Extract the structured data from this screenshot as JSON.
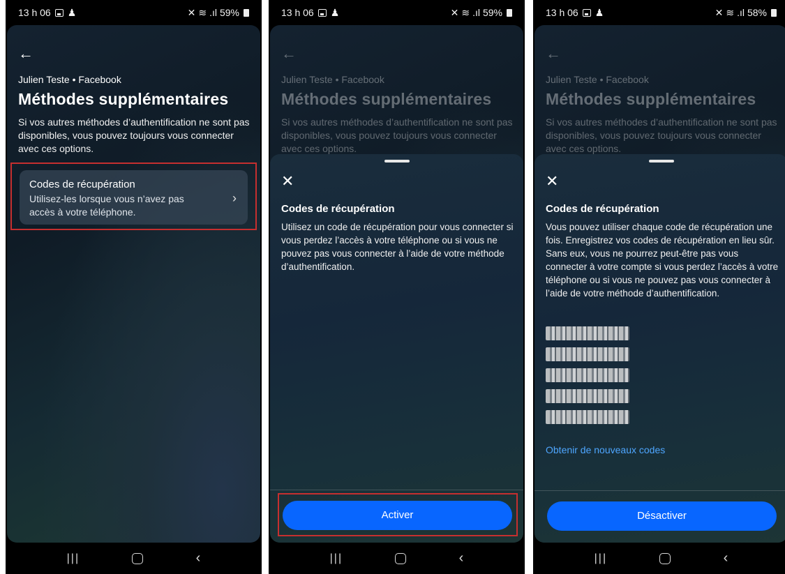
{
  "status_bars": [
    {
      "time": "13 h 06",
      "battery": "59%"
    },
    {
      "time": "13 h 06",
      "battery": "59%"
    },
    {
      "time": "13 h 06",
      "battery": "58%"
    }
  ],
  "page": {
    "account": "Julien Teste • Facebook",
    "title": "Méthodes supplémentaires",
    "description": "Si vos autres méthodes d’authentification ne sont pas disponibles, vous pouvez toujours vous connecter avec ces options.",
    "option": {
      "title": "Codes de récupération",
      "subtitle": "Utilisez-les lorsque vous n’avez pas accès à votre téléphone."
    }
  },
  "sheet_enable": {
    "title": "Codes de récupération",
    "body": "Utilisez un code de récupération pour vous connecter si vous perdez l’accès à votre téléphone ou si vous ne pouvez pas vous connecter à l’aide de votre méthode d’authentification.",
    "button": "Activer"
  },
  "sheet_disable": {
    "title": "Codes de récupération",
    "body": "Vous pouvez utiliser chaque code de récupération une fois. Enregistrez vos codes de récupération en lieu sûr. Sans eux, vous ne pourrez peut-être pas vous connecter à votre compte si vous perdez l’accès à votre téléphone ou si vous ne pouvez pas vous connecter à l’aide de votre méthode d’authentification.",
    "codes": [
      "",
      "",
      "",
      "",
      ""
    ],
    "link": "Obtenir de nouveaux codes",
    "button": "Désactiver"
  },
  "icons": {
    "back": "back-arrow-icon",
    "close": "close-icon",
    "chevron": "chevron-right-icon"
  },
  "colors": {
    "accent": "#0866ff",
    "link": "#4ea6ff",
    "highlight": "#c62f2f"
  }
}
